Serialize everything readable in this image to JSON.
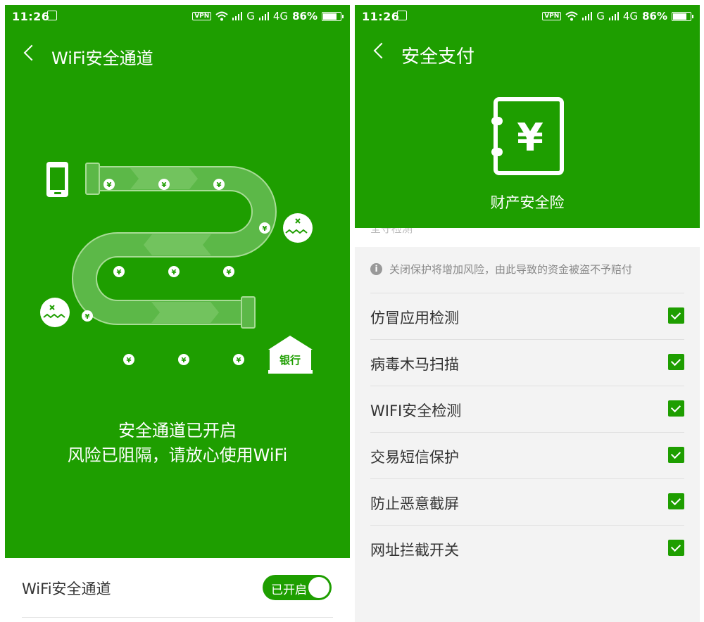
{
  "left": {
    "status": {
      "time": "11:26",
      "vpn": "VPN",
      "net1": "G",
      "net2": "4G",
      "battery": "86%"
    },
    "title": "WiFi安全通道",
    "tunnel": {
      "coin": "¥",
      "bank": "银行"
    },
    "message_line1": "安全通道已开启",
    "message_line2": "风险已阻隔，请放心使用WiFi",
    "wifi_row": {
      "label": "WiFi安全通道",
      "toggle_label": "已开启"
    }
  },
  "right": {
    "status": {
      "time": "11:26",
      "vpn": "VPN",
      "net1": "G",
      "net2": "4G",
      "battery": "86%"
    },
    "title": "安全支付",
    "vault": {
      "symbol": "¥",
      "label": "财产安全险"
    },
    "strip_text": "全守检测",
    "notice": {
      "icon": "i",
      "text": "关闭保护将增加风险，由此导致的资金被盗不予赔付"
    },
    "options": [
      {
        "label": "仿冒应用检测",
        "checked": true
      },
      {
        "label": "病毒木马扫描",
        "checked": true
      },
      {
        "label": "WIFI安全检测",
        "checked": true
      },
      {
        "label": "交易短信保护",
        "checked": true
      },
      {
        "label": "防止恶意截屏",
        "checked": true
      },
      {
        "label": "网址拦截开关",
        "checked": true
      }
    ]
  },
  "colors": {
    "green": "#1e9e00",
    "tunnel": "#5cb848",
    "tunnel_border": "#a8dc96"
  }
}
